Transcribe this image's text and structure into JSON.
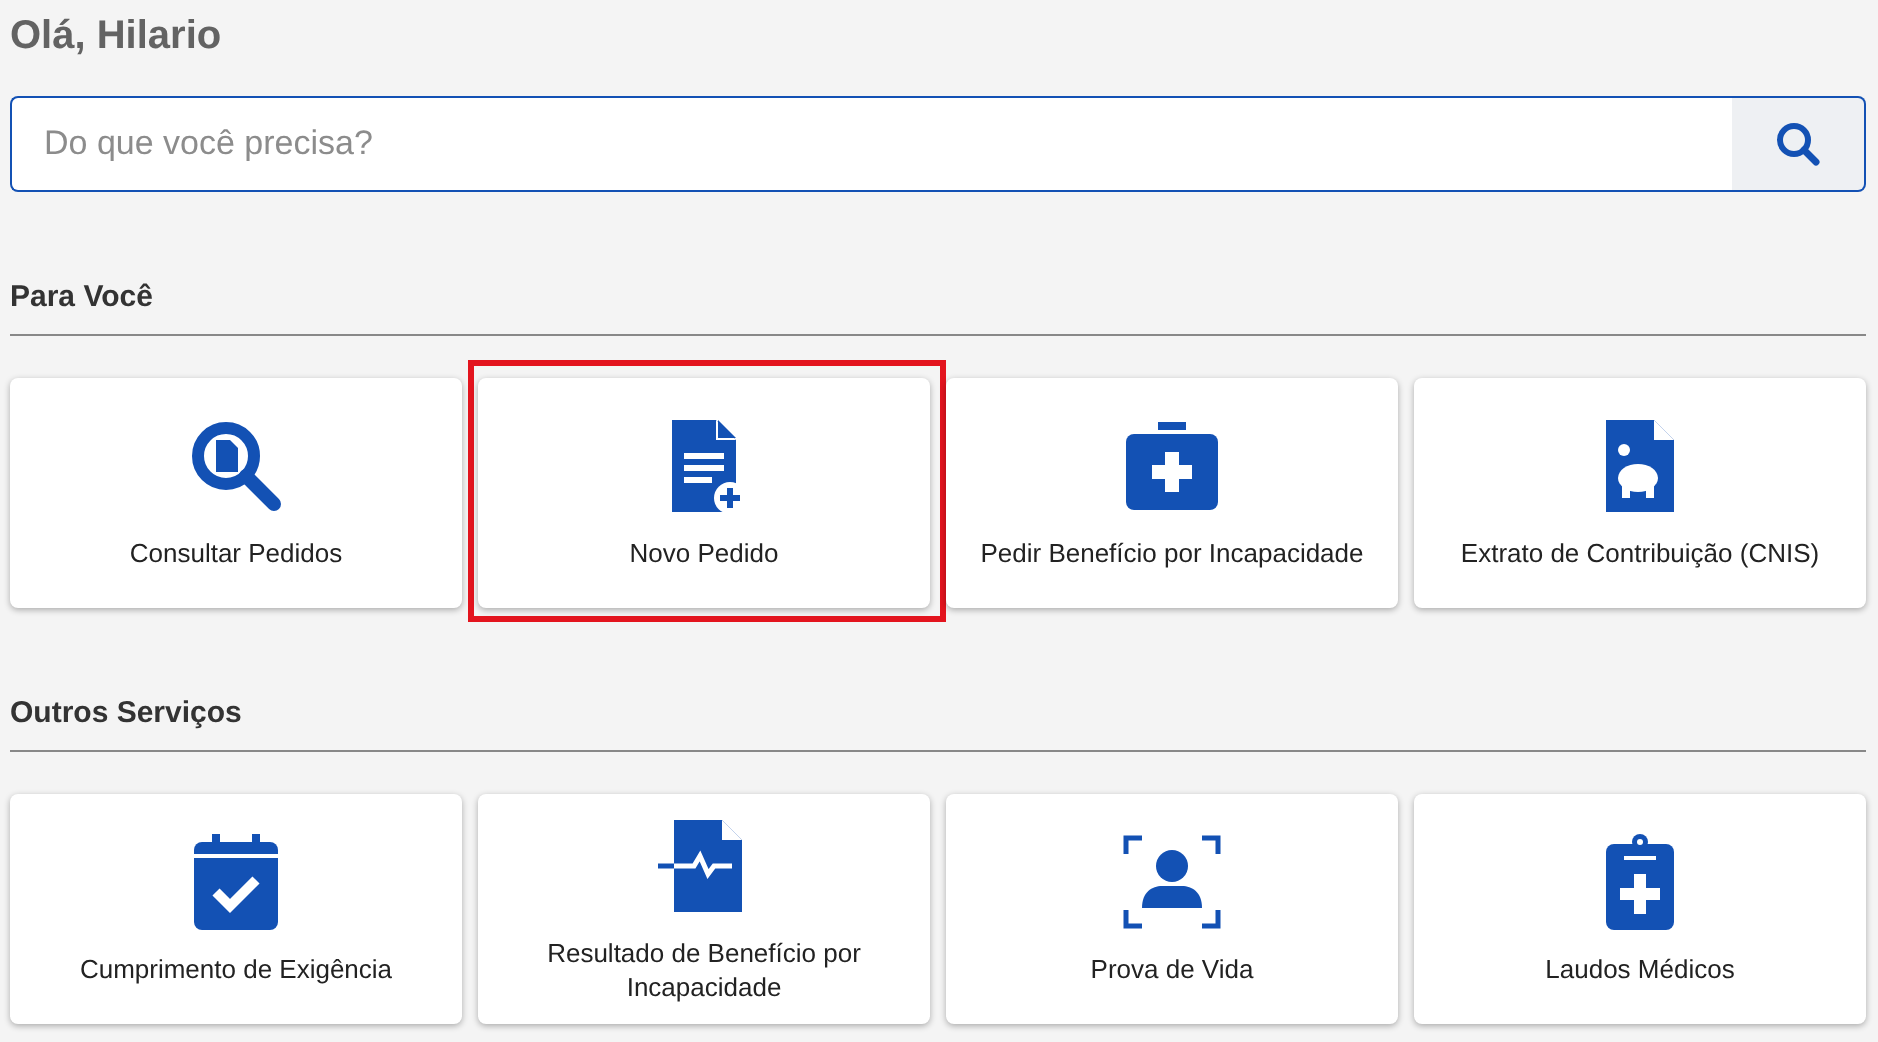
{
  "greeting": "Olá, Hilario",
  "search": {
    "placeholder": "Do que você precisa?"
  },
  "sections": [
    {
      "title": "Para Você",
      "cards": [
        {
          "label": "Consultar Pedidos",
          "highlighted": false
        },
        {
          "label": "Novo Pedido",
          "highlighted": true
        },
        {
          "label": "Pedir Benefício por Incapacidade",
          "highlighted": false
        },
        {
          "label": "Extrato de Contribuição (CNIS)",
          "highlighted": false
        }
      ]
    },
    {
      "title": "Outros Serviços",
      "cards": [
        {
          "label": "Cumprimento de Exigência",
          "highlighted": false
        },
        {
          "label": "Resultado de Benefício por Incapacidade",
          "highlighted": false
        },
        {
          "label": "Prova de Vida",
          "highlighted": false
        },
        {
          "label": "Laudos Médicos",
          "highlighted": false
        }
      ]
    }
  ]
}
